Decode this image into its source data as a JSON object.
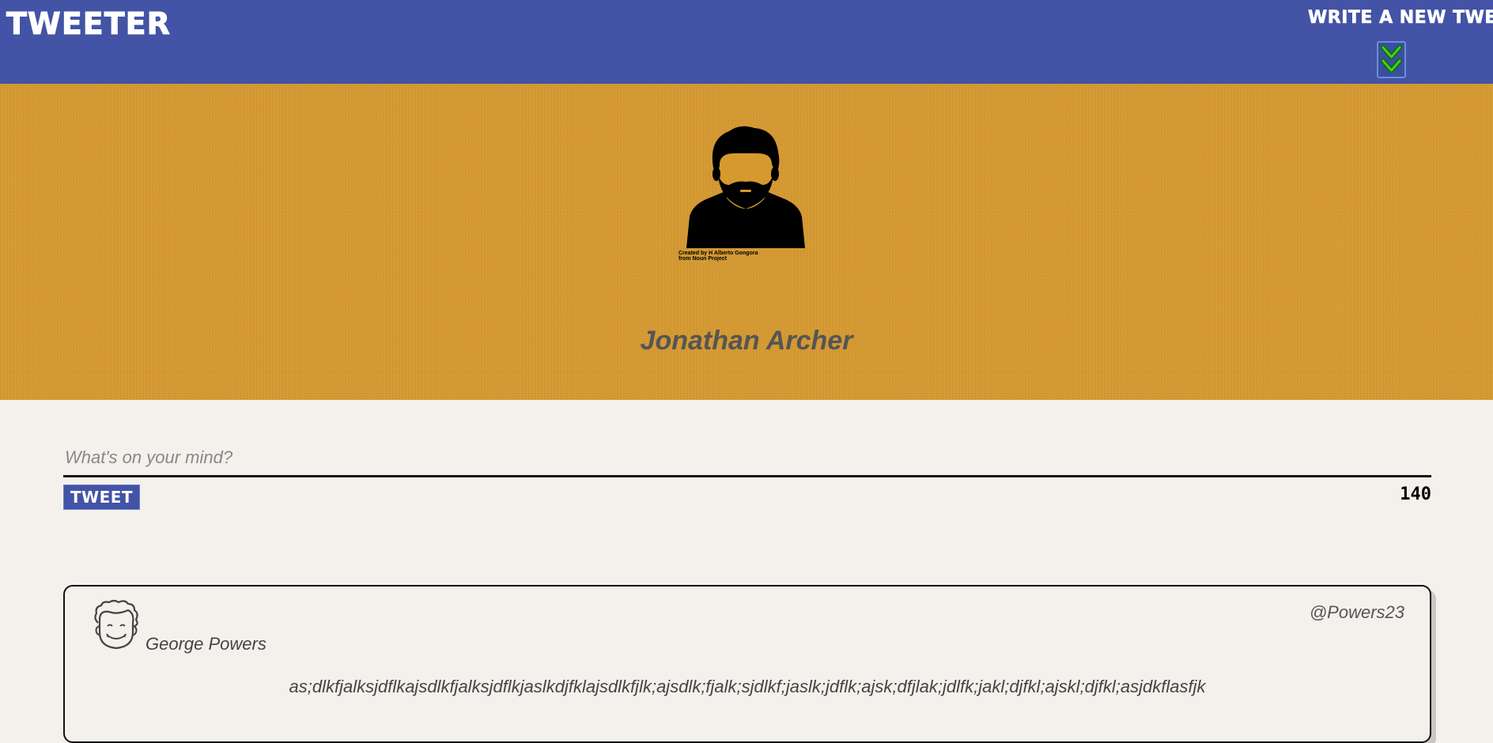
{
  "app": {
    "brand": "Tweeter"
  },
  "nav": {
    "compose_label": "Write a new tweet",
    "toggle_icon": "double-chevron-down-icon"
  },
  "profile": {
    "avatar_icon": "bearded-man-icon",
    "credit_line1": "Created by H Alberto Gongora",
    "credit_line2": "from Noun Project",
    "name": "Jonathan Archer"
  },
  "compose": {
    "placeholder": "What's on your mind?",
    "value": "",
    "button_label": "Tweet",
    "counter": "140"
  },
  "tweets": [
    {
      "avatar_icon": "curly-hair-face-icon",
      "name": "George Powers",
      "handle": "@Powers23",
      "text": "as;dlkfjalksjdflkajsdlkfjalksjdflkjaslkdjfklajsdlkfjlk;ajsdlk;fjalk;sjdlkf;jaslk;jdflk;ajsk;dfjlak;jdlfk;jakl;djfkl;ajskl;djfkl;asjdkflasfjk"
    }
  ],
  "colors": {
    "nav_bg": "#4353a5",
    "banner_bg": "#d6992f",
    "page_bg": "#f4f1ec",
    "chevron": "#3fd21a"
  }
}
